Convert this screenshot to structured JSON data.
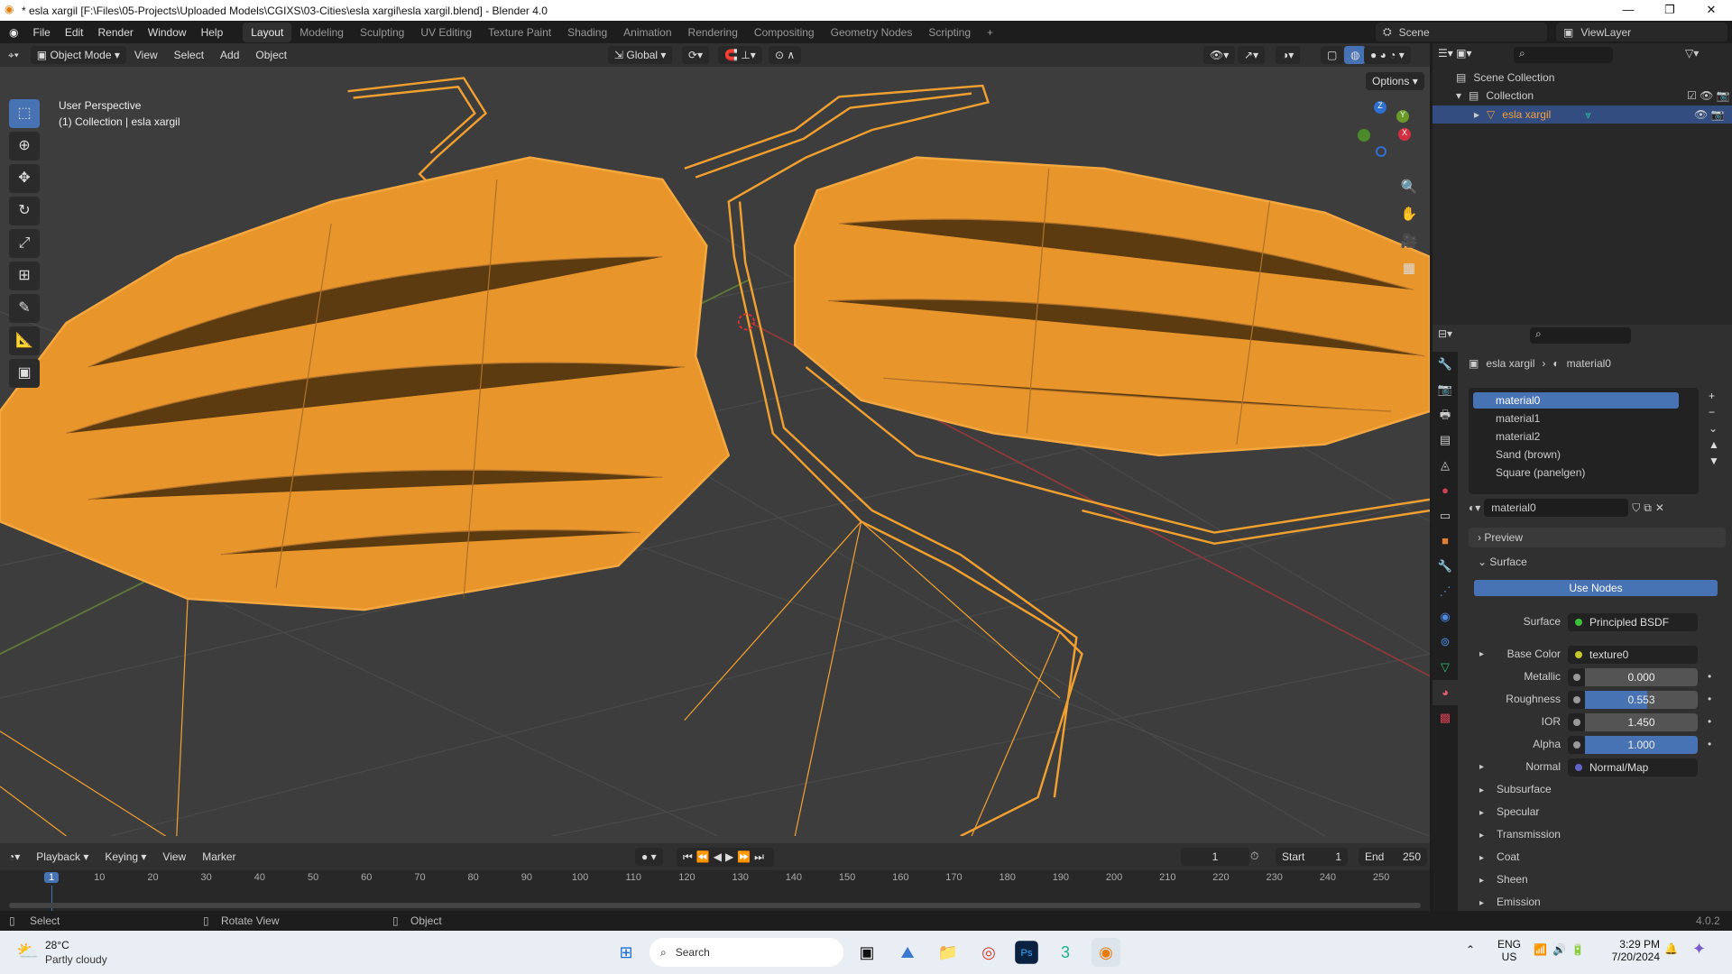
{
  "window": {
    "title": "* esla xargil [F:\\Files\\05-Projects\\Uploaded Models\\CGIXS\\03-Cities\\esla xargil\\esla xargil.blend] - Blender 4.0"
  },
  "menu": [
    "File",
    "Edit",
    "Render",
    "Window",
    "Help"
  ],
  "workspaces": [
    "Layout",
    "Modeling",
    "Sculpting",
    "UV Editing",
    "Texture Paint",
    "Shading",
    "Animation",
    "Rendering",
    "Compositing",
    "Geometry Nodes",
    "Scripting",
    "+"
  ],
  "scene": {
    "scene_name": "Scene",
    "view_layer": "ViewLayer"
  },
  "viewport_header": {
    "mode": "Object Mode",
    "menus": [
      "View",
      "Select",
      "Add",
      "Object"
    ],
    "orientation": "Global",
    "options": "Options"
  },
  "viewport": {
    "perspective": "User Perspective",
    "collection_info": "(1) Collection | esla xargil",
    "accent": "#f0a030"
  },
  "outliner": {
    "items": [
      {
        "label": "Scene Collection"
      },
      {
        "label": "Collection"
      },
      {
        "label": "esla xargil",
        "selected": true
      }
    ]
  },
  "properties": {
    "breadcrumb": {
      "object": "esla xargil",
      "material": "material0"
    },
    "material_slots": [
      "material0",
      "material1",
      "material2",
      "Sand (brown)",
      "Square (panelgen)"
    ],
    "selected_material": "material0",
    "panels": {
      "preview": "Preview",
      "surface": "Surface",
      "use_nodes": "Use Nodes"
    },
    "surface": {
      "label": "Surface",
      "value": "Principled BSDF"
    },
    "inputs": [
      {
        "label": "Base Color",
        "value": "texture0",
        "socket": "#c7c729"
      },
      {
        "label": "Metallic",
        "value": "0.000",
        "fraction": 0.0
      },
      {
        "label": "Roughness",
        "value": "0.553",
        "fraction": 0.553
      },
      {
        "label": "IOR",
        "value": "1.450",
        "fraction": 0.0
      },
      {
        "label": "Alpha",
        "value": "1.000",
        "fraction": 1.0
      },
      {
        "label": "Normal",
        "value": "Normal/Map",
        "socket": "#6363c7"
      }
    ],
    "subpanels": [
      "Subsurface",
      "Specular",
      "Transmission",
      "Coat",
      "Sheen",
      "Emission"
    ]
  },
  "timeline": {
    "menus": [
      "Playback",
      "Keying",
      "View",
      "Marker"
    ],
    "current_frame": "1",
    "start_label": "Start",
    "start": "1",
    "end_label": "End",
    "end": "250",
    "ticks": [
      "1",
      "10",
      "20",
      "30",
      "40",
      "50",
      "60",
      "70",
      "80",
      "90",
      "100",
      "110",
      "120",
      "130",
      "140",
      "150",
      "160",
      "170",
      "180",
      "190",
      "200",
      "210",
      "220",
      "230",
      "240",
      "250"
    ]
  },
  "statusbar": {
    "items": [
      "Select",
      "Rotate View",
      "Object"
    ],
    "version": "4.0.2"
  },
  "taskbar": {
    "temp": "28°C",
    "weather": "Partly cloudy",
    "search": "Search",
    "lang1": "ENG",
    "lang2": "US",
    "time": "3:29 PM",
    "date": "7/20/2024"
  }
}
